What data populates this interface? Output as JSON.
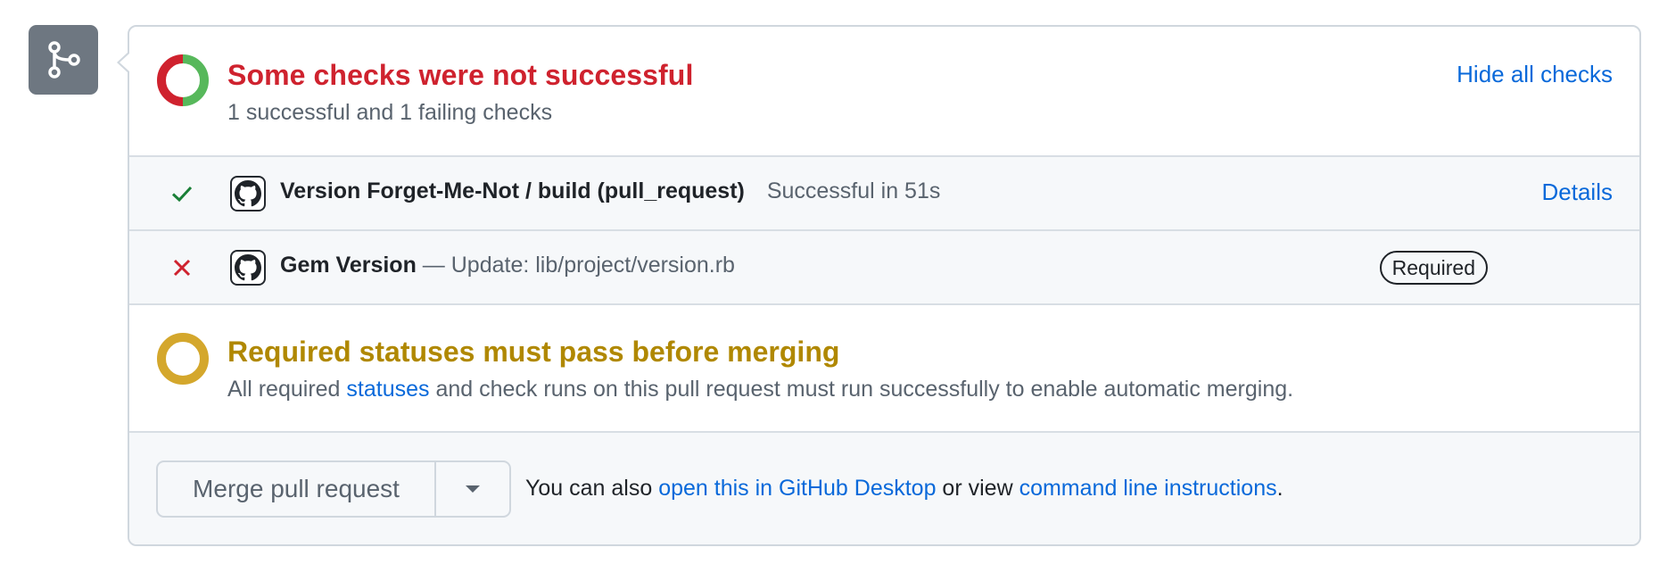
{
  "icons": {
    "merge": "git-merge-icon",
    "summary_ring": "donut-status-icon",
    "success": "check-icon",
    "failure": "x-icon",
    "github_app": "github-mark-icon",
    "pending_ring": "pending-ring-icon",
    "caret": "triangle-down-icon"
  },
  "colors": {
    "danger": "#cf222e",
    "success": "#2da44e",
    "attention": "#b08800",
    "link": "#0969da",
    "muted": "#59636e"
  },
  "summary": {
    "title": "Some checks were not successful",
    "subtitle": "1 successful and 1 failing checks",
    "toggle_label": "Hide all checks"
  },
  "checks": [
    {
      "name": "Version Forget-Me-Not / build (pull_request)",
      "description": "Successful in 51s",
      "status": "success",
      "action_label": "Details"
    },
    {
      "name": "Gem Version",
      "description": " — Update: lib/project/version.rb",
      "status": "failure",
      "badge": "Required"
    }
  ],
  "required_statuses": {
    "title": "Required statuses must pass before merging",
    "desc_before": "All required ",
    "desc_link": "statuses",
    "desc_after": " and check runs on this pull request must run successfully to enable automatic merging."
  },
  "merge": {
    "button_label": "Merge pull request",
    "note_before": "You can also ",
    "note_link1": "open this in GitHub Desktop",
    "note_middle": " or view ",
    "note_link2": "command line instructions",
    "note_after": "."
  }
}
